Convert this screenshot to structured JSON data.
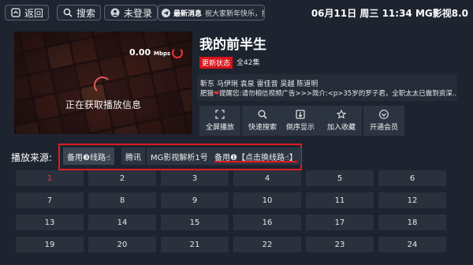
{
  "topbar": {
    "back_label": "返回",
    "search_label": "搜索",
    "login_label": "未登录",
    "news_label": "最新消息",
    "news_text": "祝大家新年快乐，接口(",
    "status": "06月11日 周三 11:34   MG影视8.0"
  },
  "player": {
    "speed_value": "0.00",
    "speed_unit": "Mbps",
    "loading_text": "正在获取播放信息"
  },
  "detail": {
    "title": "我的前半生",
    "update_badge": "更新状态",
    "episodes_total": "全42集",
    "cast": "靳东 马伊琍 袁泉 雷佳音 吴越 陈道明",
    "desc_prefix": "肥猫",
    "desc_text": "提醒您:请勿相信视频广告>>>简介:<p>35岁的罗子君，全职太太已做到资深..."
  },
  "actions": [
    {
      "label": "全屏播放",
      "icon": "fullscreen-icon"
    },
    {
      "label": "快速搜索",
      "icon": "search-icon"
    },
    {
      "label": "倒序显示",
      "icon": "sort-icon"
    },
    {
      "label": "加入收藏",
      "icon": "star-icon"
    },
    {
      "label": "开通会员",
      "icon": "vip-icon"
    }
  ],
  "sources": {
    "label": "播放来源:",
    "items": [
      "备用❸线路☝",
      "腾讯",
      "MG影视解析1号",
      "备用❶【点击换线路☝】"
    ]
  },
  "episodes": [
    "1",
    "2",
    "3",
    "4",
    "5",
    "6",
    "7",
    "8",
    "9",
    "10",
    "11",
    "12",
    "13",
    "14",
    "15",
    "16",
    "17",
    "18",
    "19",
    "20",
    "21",
    "22",
    "23",
    "24"
  ],
  "current_episode": "1",
  "colors": {
    "accent_red": "#e01b22",
    "background": "#1d2430"
  }
}
